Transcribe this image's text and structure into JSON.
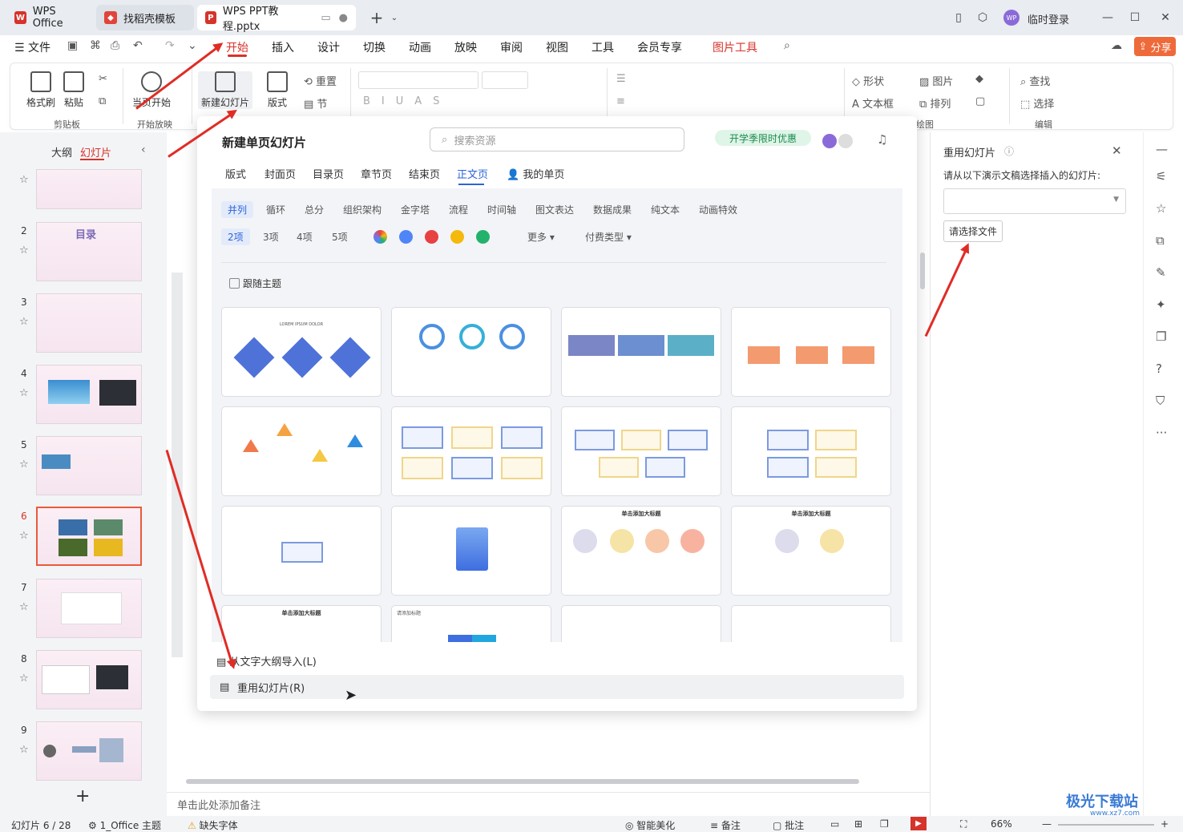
{
  "tabs": {
    "wps": "WPS Office",
    "template": "找稻壳模板",
    "document": "WPS PPT教程.pptx"
  },
  "window": {
    "login": "临时登录",
    "avatar": "WP",
    "share": "分享"
  },
  "menu": {
    "file": "文件",
    "items": [
      "开始",
      "插入",
      "设计",
      "切换",
      "动画",
      "放映",
      "审阅",
      "视图",
      "工具",
      "会员专享"
    ],
    "picture_tools": "图片工具"
  },
  "ribbon": {
    "format_painter": "格式刷",
    "paste": "粘贴",
    "clipboard": "剪贴板",
    "start_here": "当页开始",
    "start_show": "开始放映",
    "new_slide": "新建幻灯片",
    "layout": "版式",
    "reset": "重置",
    "section": "节",
    "shape": "形状",
    "picture": "图片",
    "textbox": "文本框",
    "arrange": "排列",
    "drawing": "绘图",
    "find": "查找",
    "select": "选择",
    "edit": "编辑"
  },
  "left": {
    "outline": "大纲",
    "slides": "幻灯片",
    "slide_numbers": [
      "2",
      "3",
      "4",
      "5",
      "6",
      "7",
      "8",
      "9"
    ],
    "add": "+",
    "thumb_text": {
      "s2_title": "目录"
    }
  },
  "popup": {
    "title": "新建单页幻灯片",
    "search_placeholder": "搜索资源",
    "promo": "开学季限时优惠",
    "tabs": [
      "版式",
      "封面页",
      "目录页",
      "章节页",
      "结束页",
      "正文页",
      "我的单页"
    ],
    "categories": [
      "并列",
      "循环",
      "总分",
      "组织架构",
      "金字塔",
      "流程",
      "时间轴",
      "图文表达",
      "数据成果",
      "纯文本",
      "动画特效"
    ],
    "counts": [
      "2项",
      "3项",
      "4项",
      "5项"
    ],
    "colors": [
      "#4f86f7",
      "#e84141",
      "#f5b90b",
      "#22b26c"
    ],
    "more": "更多",
    "pay_type": "付费类型",
    "follow_theme": "跟随主题",
    "import_outline": "从文字大纲导入(L)",
    "reuse_slides": "重用幻灯片(R)",
    "card_titles": {
      "c1": "LOREM IPSUM DOLOR",
      "c9": "单击添加大标题",
      "c12": "单击添加大标题",
      "c13": "单击添加大标题",
      "c14": "请添加标题"
    }
  },
  "reuse_pane": {
    "title": "重用幻灯片",
    "prompt": "请从以下演示文稿选择插入的幻灯片:",
    "select_file": "请选择文件"
  },
  "notes": "单击此处添加备注",
  "status": {
    "slide_pos": "幻灯片 6 / 28",
    "theme": "1_Office 主题",
    "missing_font": "缺失字体",
    "beautify": "智能美化",
    "notes": "备注",
    "comments": "批注",
    "zoom": "66%"
  },
  "watermark": {
    "name": "极光下载站",
    "url": "www.xz7.com"
  },
  "colors": {
    "accent": "#d6332b",
    "blue": "#2b63d9",
    "arrow": "#e02c25"
  }
}
